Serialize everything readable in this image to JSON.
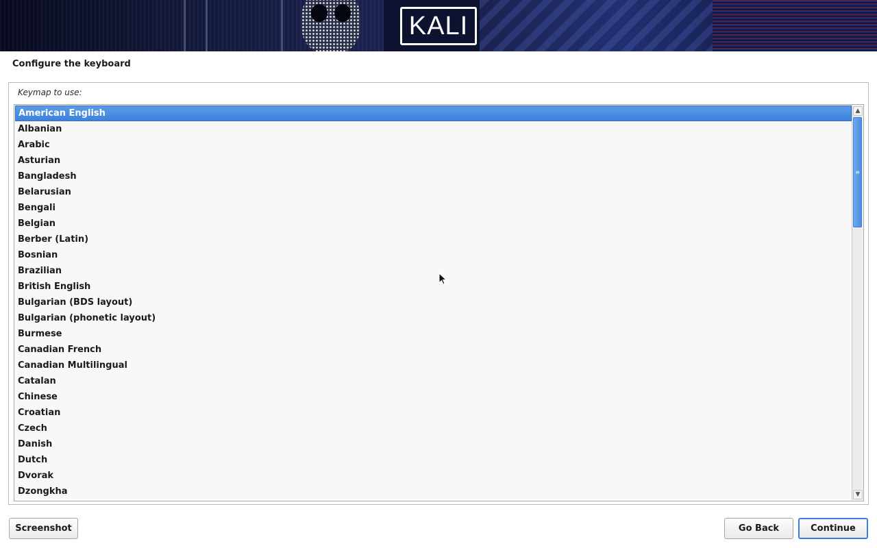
{
  "banner": {
    "logo_text": "KALI"
  },
  "page": {
    "title": "Configure the keyboard"
  },
  "keymap": {
    "label": "Keymap to use:",
    "selected": "American English",
    "items": [
      "American English",
      "Albanian",
      "Arabic",
      "Asturian",
      "Bangladesh",
      "Belarusian",
      "Bengali",
      "Belgian",
      "Berber (Latin)",
      "Bosnian",
      "Brazilian",
      "British English",
      "Bulgarian (BDS layout)",
      "Bulgarian (phonetic layout)",
      "Burmese",
      "Canadian French",
      "Canadian Multilingual",
      "Catalan",
      "Chinese",
      "Croatian",
      "Czech",
      "Danish",
      "Dutch",
      "Dvorak",
      "Dzongkha"
    ]
  },
  "buttons": {
    "screenshot": "Screenshot",
    "go_back": "Go Back",
    "continue": "Continue"
  },
  "colors": {
    "selection": "#3d82dd",
    "banner_bg": "#0d1230"
  },
  "icons": {
    "scroll_up": "chevron-up-icon",
    "scroll_down": "chevron-down-icon",
    "cursor": "mouse-pointer-icon"
  }
}
